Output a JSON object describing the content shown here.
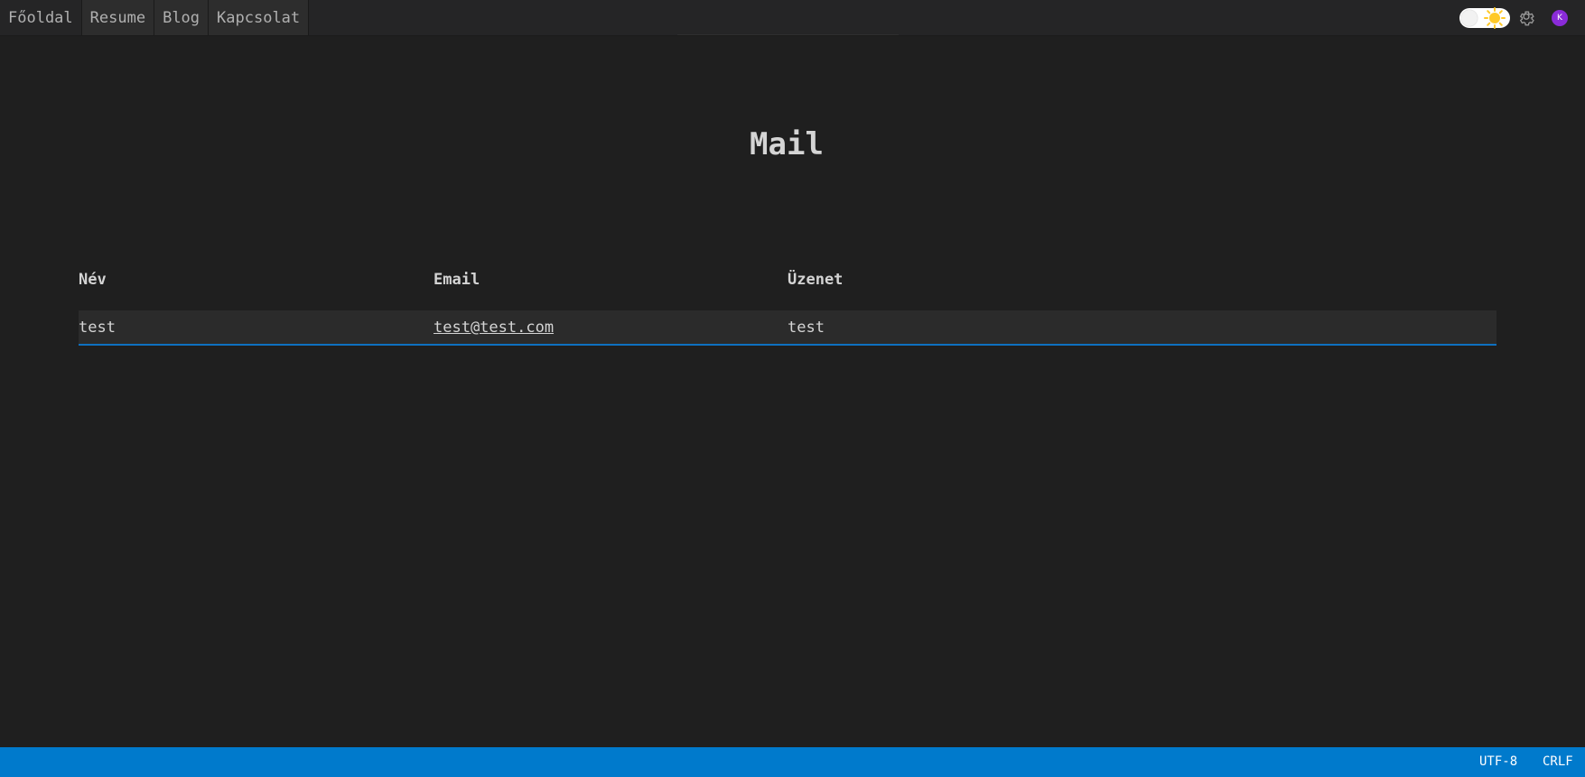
{
  "nav": {
    "tabs": [
      {
        "label": "Főoldal"
      },
      {
        "label": "Resume"
      },
      {
        "label": "Blog"
      },
      {
        "label": "Kapcsolat"
      }
    ]
  },
  "header_controls": {
    "theme_toggle": {
      "state": "light",
      "icon": "sun-icon"
    },
    "settings_icon": "gear-icon",
    "avatar_initial": "K",
    "avatar_color": "#8a2bd8"
  },
  "main": {
    "title": "Mail",
    "table": {
      "headers": [
        "Név",
        "Email",
        "Üzenet"
      ],
      "rows": [
        {
          "name": "test",
          "email": "test@test.com",
          "message": "test"
        }
      ]
    }
  },
  "statusbar": {
    "encoding": "UTF-8",
    "line_ending": "CRLF",
    "color": "#007acc"
  },
  "colors": {
    "background": "#1f1f1f",
    "accent": "#0e70c0"
  }
}
